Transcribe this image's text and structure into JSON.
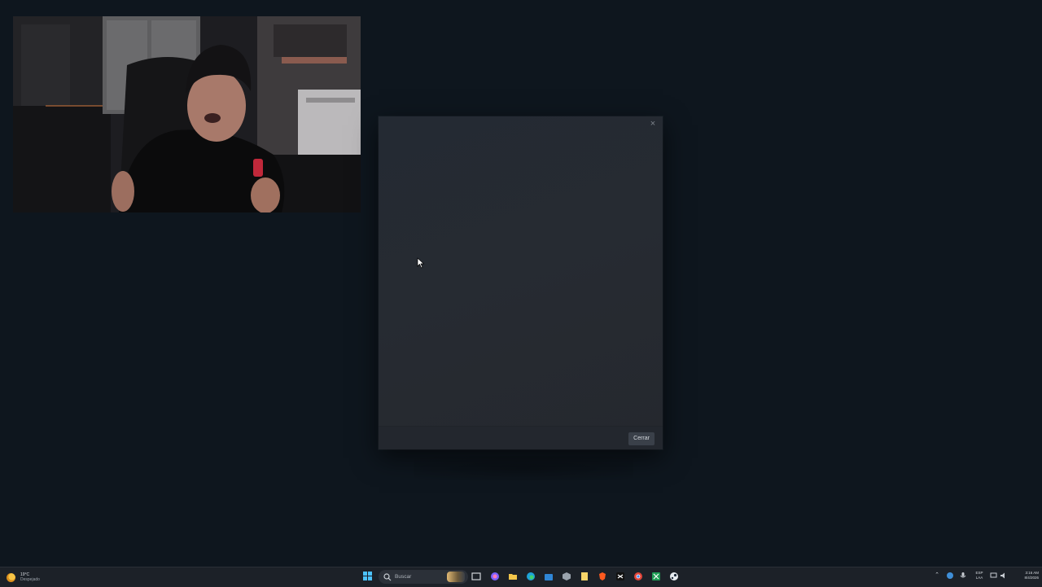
{
  "dialog": {
    "close_x": "×",
    "close_button_label": "Cerrar"
  },
  "taskbar": {
    "weather": {
      "temperature": "19°C",
      "condition": "Despejado"
    },
    "search_placeholder": "Buscar",
    "pinned_icons": [
      "explorer-icon",
      "copilot-icon",
      "folder-icon",
      "edge-icon",
      "store-icon",
      "app-icon",
      "notes-icon",
      "brave-icon",
      "capcut-icon",
      "chrome-icon",
      "spreadsheet-icon",
      "steam-icon"
    ],
    "tray": {
      "language_top": "ESP",
      "language_bottom": "LAA",
      "time": "3:16 AM",
      "date": "8/4/2026"
    }
  },
  "colors": {
    "desktop_bg": "#0e161e",
    "dialog_bg": "#252a31",
    "accent": "#4cc2ff"
  }
}
